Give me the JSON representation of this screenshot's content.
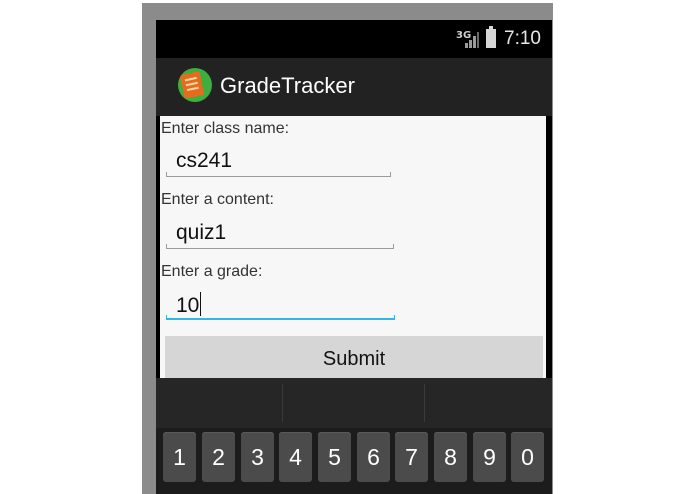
{
  "status_bar": {
    "network": "3G",
    "time": "7:10"
  },
  "app": {
    "title": "GradeTracker"
  },
  "form": {
    "class_label": "Enter class name:",
    "class_value": "cs241",
    "content_label": "Enter a content:",
    "content_value": "quiz1",
    "grade_label": "Enter a grade:",
    "grade_value": "10",
    "submit_label": "Submit"
  },
  "keyboard": {
    "keys": [
      "1",
      "2",
      "3",
      "4",
      "5",
      "6",
      "7",
      "8",
      "9",
      "0"
    ]
  },
  "colors": {
    "accent": "#33b5e5",
    "action_bar": "#222222",
    "keyboard_bg": "#1c1c1c",
    "key": "#4b4b4b"
  }
}
